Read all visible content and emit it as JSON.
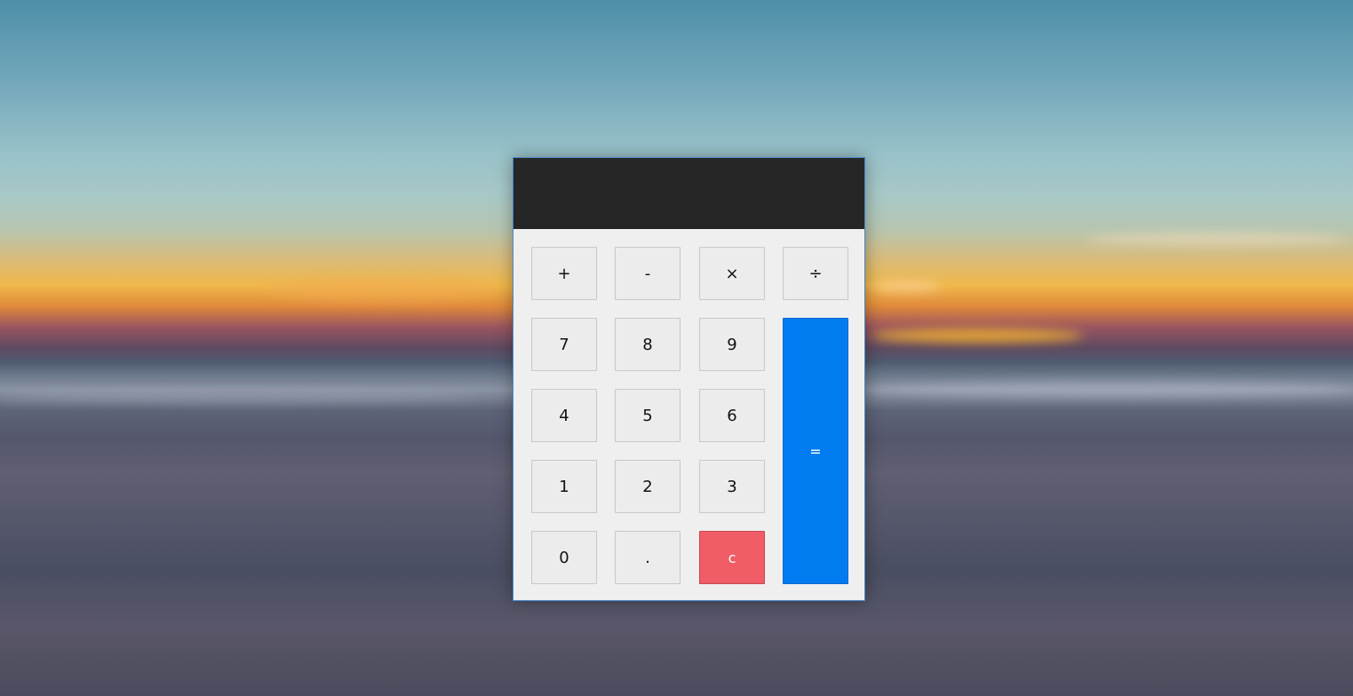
{
  "display": {
    "value": ""
  },
  "keys": {
    "plus": "+",
    "minus": "-",
    "multiply": "×",
    "divide": "÷",
    "seven": "7",
    "eight": "8",
    "nine": "9",
    "four": "4",
    "five": "5",
    "six": "6",
    "one": "1",
    "two": "2",
    "three": "3",
    "zero": "0",
    "decimal": ".",
    "clear": "c",
    "equals": "="
  },
  "colors": {
    "display_bg": "#262626",
    "key_bg": "#ececec",
    "clear_bg": "#f05d66",
    "equals_bg": "#007cf0"
  }
}
